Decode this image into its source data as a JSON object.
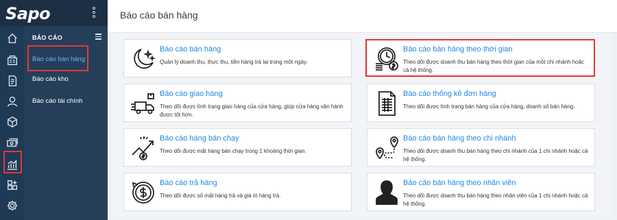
{
  "brand": {
    "logo_text": "Sapo"
  },
  "rail": {
    "icons": [
      "home-icon",
      "store-icon",
      "orders-icon",
      "customer-icon",
      "product-icon",
      "cashbook-icon",
      "report-icon",
      "apps-icon",
      "settings-icon"
    ],
    "active_icon": "report-icon",
    "highlight_color": "#e53935"
  },
  "subnav": {
    "title": "BÁO CÁO",
    "items": [
      {
        "label": "Báo cáo bán hàng",
        "active": true
      },
      {
        "label": "Báo cáo kho",
        "active": false
      },
      {
        "label": "Báo cáo tài chính",
        "active": false
      }
    ]
  },
  "header": {
    "title": "Báo cáo bán hàng"
  },
  "cards": [
    {
      "icon": "night-moon-icon",
      "title": "Báo cáo bán hàng",
      "desc": "Quản lý doanh thu, thực thu, tiền hàng trả lại trong một ngày.",
      "highlighted": false
    },
    {
      "icon": "clock-money-icon",
      "title": "Báo cáo bán hàng theo thời gian",
      "desc": "Theo dõi được doanh thu bán hàng theo thời gian của một chi nhánh hoặc cả hệ thống.",
      "highlighted": true
    },
    {
      "icon": "delivery-truck-icon",
      "title": "Báo cáo giao hàng",
      "desc": "Theo dõi được tình trạng giao hàng của cửa hàng, giúp cửa hàng vận hành được tốt hơn.",
      "highlighted": false
    },
    {
      "icon": "order-document-icon",
      "title": "Báo cáo thống kê đơn hàng",
      "desc": "Theo dõi được tình trạng bán hàng của cửa hàng, doanh số bán hàng.",
      "highlighted": false
    },
    {
      "icon": "trending-money-icon",
      "title": "Báo cáo hàng bán chạy",
      "desc": "Theo dõi được mặt hàng bán chạy trong 1 khoảng thời gian.",
      "highlighted": false
    },
    {
      "icon": "branch-route-icon",
      "title": "Báo cáo bán hàng theo chi nhánh",
      "desc": "Theo dõi được doanh thu bán hàng theo chi nhánh của 1 chi nhánh hoặc cả hệ thống.",
      "highlighted": false
    },
    {
      "icon": "return-money-icon",
      "title": "Báo cáo trả hàng",
      "desc": "Theo dõi được số mặt hàng trả và giá trị hàng trả.",
      "highlighted": false
    },
    {
      "icon": "employee-icon",
      "title": "Báo cáo bán hàng theo nhân viên",
      "desc": "Theo dõi được doanh thu bán hàng theo nhân viên của 1 chi nhánh hoặc cả hệ thống.",
      "highlighted": false
    }
  ],
  "colors": {
    "link": "#1e88e5",
    "sidebar": "#253f5a",
    "rail": "#1f3a55",
    "active_link": "#5fb7ff"
  }
}
